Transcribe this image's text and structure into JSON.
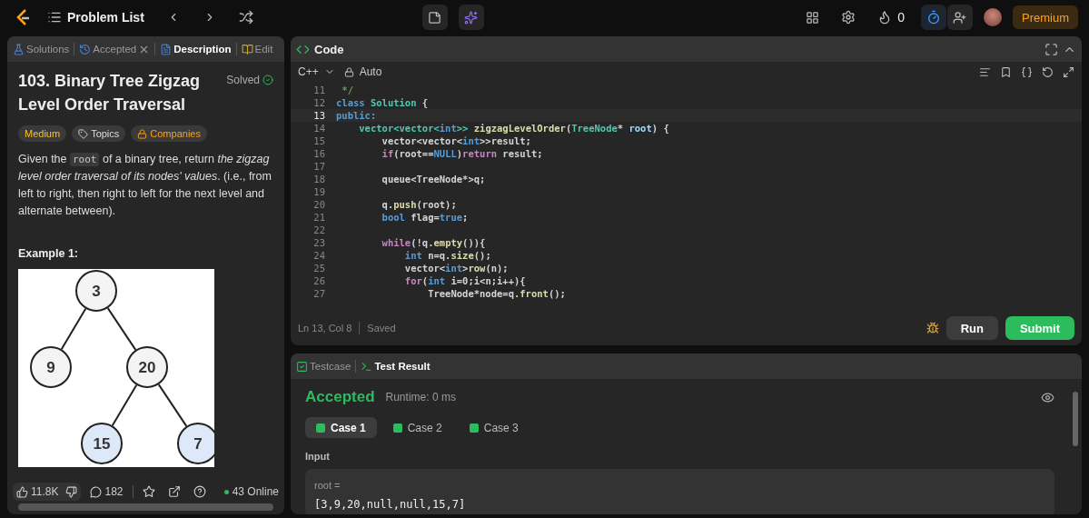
{
  "topbar": {
    "problem_list": "Problem List",
    "streak": "0",
    "timer_on": true,
    "premium": "Premium"
  },
  "left_tabs": [
    {
      "label": "Solutions",
      "kind": "solutions",
      "selected": false
    },
    {
      "label": "Accepted",
      "kind": "accepted",
      "selected": false
    },
    {
      "label": "Description",
      "kind": "description",
      "selected": true
    },
    {
      "label": "Edit",
      "kind": "editorial",
      "selected": false
    }
  ],
  "problem": {
    "title": "103. Binary Tree Zigzag Level Order Traversal",
    "status": "Solved",
    "tags": [
      {
        "label": "Medium",
        "kind": "difficulty"
      },
      {
        "label": "Topics",
        "kind": "topics"
      },
      {
        "label": "Companies",
        "kind": "companies"
      }
    ],
    "description": [
      "Given the ",
      "root",
      " of a binary tree, return *the zigzag level order traversal of its nodes' values*. (i.e., from left to right, then right to left for the next level and alternate between)."
    ],
    "example_title": "Example 1:",
    "tree": {
      "value": "3",
      "highlighted": false,
      "children": [
        {
          "value": "9",
          "highlighted": false
        },
        {
          "value": "20",
          "highlighted": false,
          "children": [
            {
              "value": "15",
              "highlighted": true
            },
            {
              "value": "7",
              "highlighted": true
            }
          ]
        }
      ]
    }
  },
  "footer": {
    "likes": "11.8K",
    "comments": "182",
    "online": "43 Online"
  },
  "code_panel": {
    "title": "Code",
    "language": "C++",
    "mode": "Auto",
    "status": "Ln 13, Col 8",
    "saved": "Saved",
    "run": "Run",
    "submit": "Submit",
    "lines": [
      {
        "n": "11",
        "current": false,
        "tokens": [
          {
            "t": " */",
            "color": "#6a9955"
          }
        ]
      },
      {
        "n": "12",
        "current": false,
        "tokens": [
          {
            "t": "class ",
            "color": "#569cd6"
          },
          {
            "t": "Solution ",
            "color": "#4ec9b0"
          },
          {
            "t": "{"
          }
        ]
      },
      {
        "n": "13",
        "current": true,
        "tokens": [
          {
            "t": "public:",
            "color": "#569cd6"
          }
        ]
      },
      {
        "n": "14",
        "current": false,
        "tokens": [
          {
            "t": "    vector<vector<",
            "color": "#4ec9b0"
          },
          {
            "t": "int",
            "color": "#569cd6"
          },
          {
            "t": ">> ",
            "color": "#4ec9b0"
          },
          {
            "t": "zigzagLevelOrder",
            "color": "#dcdcaa"
          },
          {
            "t": "("
          },
          {
            "t": "TreeNode",
            "color": "#4ec9b0"
          },
          {
            "t": "* "
          },
          {
            "t": "root",
            "color": "#9cdcfe"
          },
          {
            "t": ") {"
          }
        ]
      },
      {
        "n": "15",
        "current": false,
        "tokens": [
          {
            "t": "        vector<vector<"
          },
          {
            "t": "int",
            "color": "#569cd6"
          },
          {
            "t": ">>result;"
          }
        ]
      },
      {
        "n": "16",
        "current": false,
        "tokens": [
          {
            "t": "        if",
            "color": "#c586c0"
          },
          {
            "t": "(root=="
          },
          {
            "t": "NULL",
            "color": "#569cd6"
          },
          {
            "t": ")"
          },
          {
            "t": "return",
            "color": "#c586c0"
          },
          {
            "t": " result;"
          }
        ]
      },
      {
        "n": "17",
        "current": false
      },
      {
        "n": "18",
        "current": false,
        "tokens": [
          {
            "t": "        queue<TreeNode*>q;"
          }
        ]
      },
      {
        "n": "19",
        "current": false
      },
      {
        "n": "20",
        "current": false,
        "tokens": [
          {
            "t": "        q."
          },
          {
            "t": "push",
            "color": "#dcdcaa"
          },
          {
            "t": "(root);"
          }
        ]
      },
      {
        "n": "21",
        "current": false,
        "tokens": [
          {
            "t": "        bool ",
            "color": "#569cd6"
          },
          {
            "t": "flag="
          },
          {
            "t": "true",
            "color": "#569cd6"
          },
          {
            "t": ";"
          }
        ]
      },
      {
        "n": "22",
        "current": false
      },
      {
        "n": "23",
        "current": false,
        "tokens": [
          {
            "t": "        while",
            "color": "#c586c0"
          },
          {
            "t": "(!q."
          },
          {
            "t": "empty",
            "color": "#dcdcaa"
          },
          {
            "t": "()){"
          }
        ]
      },
      {
        "n": "24",
        "current": false,
        "tokens": [
          {
            "t": "            int ",
            "color": "#569cd6"
          },
          {
            "t": "n=q."
          },
          {
            "t": "size",
            "color": "#dcdcaa"
          },
          {
            "t": "();"
          }
        ]
      },
      {
        "n": "25",
        "current": false,
        "tokens": [
          {
            "t": "            vector<"
          },
          {
            "t": "int",
            "color": "#569cd6"
          },
          {
            "t": ">"
          },
          {
            "t": "row",
            "color": "#dcdcaa"
          },
          {
            "t": "(n);"
          }
        ]
      },
      {
        "n": "26",
        "current": false,
        "tokens": [
          {
            "t": "            for",
            "color": "#c586c0"
          },
          {
            "t": "("
          },
          {
            "t": "int ",
            "color": "#569cd6"
          },
          {
            "t": "i=0;i<n;i++){"
          }
        ]
      },
      {
        "n": "27",
        "current": false,
        "tokens": [
          {
            "t": "                TreeNode*node=q."
          },
          {
            "t": "front",
            "color": "#dcdcaa"
          },
          {
            "t": "();"
          }
        ]
      }
    ]
  },
  "test_panel": {
    "tabs": [
      {
        "label": "Testcase",
        "kind": "testcase",
        "selected": false
      },
      {
        "label": "Test Result",
        "kind": "result",
        "selected": true
      }
    ],
    "verdict": "Accepted",
    "runtime": "Runtime: 0 ms",
    "cases": [
      {
        "label": "Case 1",
        "passed": true,
        "selected": true
      },
      {
        "label": "Case 2",
        "passed": true,
        "selected": false
      },
      {
        "label": "Case 3",
        "passed": true,
        "selected": false
      }
    ],
    "input_label": "Input",
    "param": "root =",
    "value": "[3,9,20,null,null,15,7]"
  }
}
